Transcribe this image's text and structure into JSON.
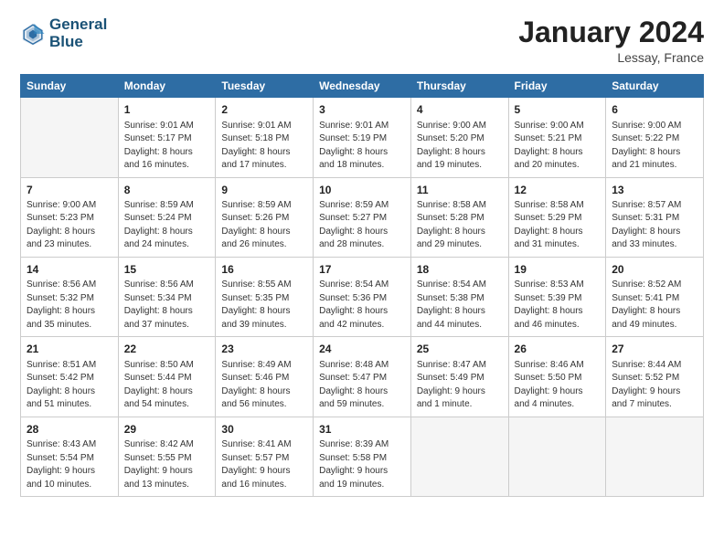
{
  "header": {
    "logo_line1": "General",
    "logo_line2": "Blue",
    "month_title": "January 2024",
    "location": "Lessay, France"
  },
  "days_of_week": [
    "Sunday",
    "Monday",
    "Tuesday",
    "Wednesday",
    "Thursday",
    "Friday",
    "Saturday"
  ],
  "weeks": [
    [
      {
        "day": "",
        "info": ""
      },
      {
        "day": "1",
        "info": "Sunrise: 9:01 AM\nSunset: 5:17 PM\nDaylight: 8 hours\nand 16 minutes."
      },
      {
        "day": "2",
        "info": "Sunrise: 9:01 AM\nSunset: 5:18 PM\nDaylight: 8 hours\nand 17 minutes."
      },
      {
        "day": "3",
        "info": "Sunrise: 9:01 AM\nSunset: 5:19 PM\nDaylight: 8 hours\nand 18 minutes."
      },
      {
        "day": "4",
        "info": "Sunrise: 9:00 AM\nSunset: 5:20 PM\nDaylight: 8 hours\nand 19 minutes."
      },
      {
        "day": "5",
        "info": "Sunrise: 9:00 AM\nSunset: 5:21 PM\nDaylight: 8 hours\nand 20 minutes."
      },
      {
        "day": "6",
        "info": "Sunrise: 9:00 AM\nSunset: 5:22 PM\nDaylight: 8 hours\nand 21 minutes."
      }
    ],
    [
      {
        "day": "7",
        "info": "Sunrise: 9:00 AM\nSunset: 5:23 PM\nDaylight: 8 hours\nand 23 minutes."
      },
      {
        "day": "8",
        "info": "Sunrise: 8:59 AM\nSunset: 5:24 PM\nDaylight: 8 hours\nand 24 minutes."
      },
      {
        "day": "9",
        "info": "Sunrise: 8:59 AM\nSunset: 5:26 PM\nDaylight: 8 hours\nand 26 minutes."
      },
      {
        "day": "10",
        "info": "Sunrise: 8:59 AM\nSunset: 5:27 PM\nDaylight: 8 hours\nand 28 minutes."
      },
      {
        "day": "11",
        "info": "Sunrise: 8:58 AM\nSunset: 5:28 PM\nDaylight: 8 hours\nand 29 minutes."
      },
      {
        "day": "12",
        "info": "Sunrise: 8:58 AM\nSunset: 5:29 PM\nDaylight: 8 hours\nand 31 minutes."
      },
      {
        "day": "13",
        "info": "Sunrise: 8:57 AM\nSunset: 5:31 PM\nDaylight: 8 hours\nand 33 minutes."
      }
    ],
    [
      {
        "day": "14",
        "info": "Sunrise: 8:56 AM\nSunset: 5:32 PM\nDaylight: 8 hours\nand 35 minutes."
      },
      {
        "day": "15",
        "info": "Sunrise: 8:56 AM\nSunset: 5:34 PM\nDaylight: 8 hours\nand 37 minutes."
      },
      {
        "day": "16",
        "info": "Sunrise: 8:55 AM\nSunset: 5:35 PM\nDaylight: 8 hours\nand 39 minutes."
      },
      {
        "day": "17",
        "info": "Sunrise: 8:54 AM\nSunset: 5:36 PM\nDaylight: 8 hours\nand 42 minutes."
      },
      {
        "day": "18",
        "info": "Sunrise: 8:54 AM\nSunset: 5:38 PM\nDaylight: 8 hours\nand 44 minutes."
      },
      {
        "day": "19",
        "info": "Sunrise: 8:53 AM\nSunset: 5:39 PM\nDaylight: 8 hours\nand 46 minutes."
      },
      {
        "day": "20",
        "info": "Sunrise: 8:52 AM\nSunset: 5:41 PM\nDaylight: 8 hours\nand 49 minutes."
      }
    ],
    [
      {
        "day": "21",
        "info": "Sunrise: 8:51 AM\nSunset: 5:42 PM\nDaylight: 8 hours\nand 51 minutes."
      },
      {
        "day": "22",
        "info": "Sunrise: 8:50 AM\nSunset: 5:44 PM\nDaylight: 8 hours\nand 54 minutes."
      },
      {
        "day": "23",
        "info": "Sunrise: 8:49 AM\nSunset: 5:46 PM\nDaylight: 8 hours\nand 56 minutes."
      },
      {
        "day": "24",
        "info": "Sunrise: 8:48 AM\nSunset: 5:47 PM\nDaylight: 8 hours\nand 59 minutes."
      },
      {
        "day": "25",
        "info": "Sunrise: 8:47 AM\nSunset: 5:49 PM\nDaylight: 9 hours\nand 1 minute."
      },
      {
        "day": "26",
        "info": "Sunrise: 8:46 AM\nSunset: 5:50 PM\nDaylight: 9 hours\nand 4 minutes."
      },
      {
        "day": "27",
        "info": "Sunrise: 8:44 AM\nSunset: 5:52 PM\nDaylight: 9 hours\nand 7 minutes."
      }
    ],
    [
      {
        "day": "28",
        "info": "Sunrise: 8:43 AM\nSunset: 5:54 PM\nDaylight: 9 hours\nand 10 minutes."
      },
      {
        "day": "29",
        "info": "Sunrise: 8:42 AM\nSunset: 5:55 PM\nDaylight: 9 hours\nand 13 minutes."
      },
      {
        "day": "30",
        "info": "Sunrise: 8:41 AM\nSunset: 5:57 PM\nDaylight: 9 hours\nand 16 minutes."
      },
      {
        "day": "31",
        "info": "Sunrise: 8:39 AM\nSunset: 5:58 PM\nDaylight: 9 hours\nand 19 minutes."
      },
      {
        "day": "",
        "info": ""
      },
      {
        "day": "",
        "info": ""
      },
      {
        "day": "",
        "info": ""
      }
    ]
  ]
}
